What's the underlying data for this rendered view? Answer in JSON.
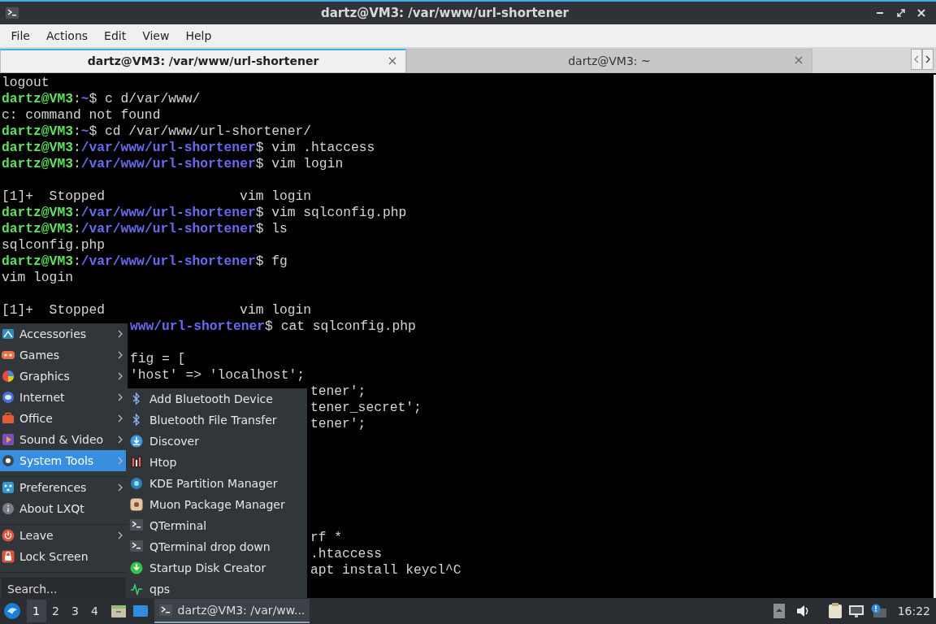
{
  "window": {
    "title": "dartz@VM3: /var/www/url-shortener"
  },
  "menu_bar": [
    "File",
    "Actions",
    "Edit",
    "View",
    "Help"
  ],
  "tabs": [
    {
      "label": "dartz@VM3: /var/www/url-shortener",
      "selected": true
    },
    {
      "label": "dartz@VM3: ~",
      "selected": false
    }
  ],
  "terminal": {
    "lines": [
      {
        "kind": "full",
        "segments": [
          {
            "kind": "text",
            "text": "logout"
          }
        ]
      },
      {
        "kind": "full",
        "segments": [
          {
            "kind": "user",
            "text": "dartz@VM3"
          },
          {
            "kind": "text",
            "text": ":"
          },
          {
            "kind": "path",
            "text": "~"
          },
          {
            "kind": "text",
            "text": "$ c d/var/www/"
          }
        ]
      },
      {
        "kind": "full",
        "segments": [
          {
            "kind": "text",
            "text": "c: command not found"
          }
        ]
      },
      {
        "kind": "full",
        "segments": [
          {
            "kind": "user",
            "text": "dartz@VM3"
          },
          {
            "kind": "text",
            "text": ":"
          },
          {
            "kind": "path",
            "text": "~"
          },
          {
            "kind": "text",
            "text": "$ cd /var/www/url-shortener/"
          }
        ]
      },
      {
        "kind": "full",
        "segments": [
          {
            "kind": "user",
            "text": "dartz@VM3"
          },
          {
            "kind": "text",
            "text": ":"
          },
          {
            "kind": "path",
            "text": "/var/www/url-shortener"
          },
          {
            "kind": "text",
            "text": "$ vim .htaccess"
          }
        ]
      },
      {
        "kind": "full",
        "segments": [
          {
            "kind": "user",
            "text": "dartz@VM3"
          },
          {
            "kind": "text",
            "text": ":"
          },
          {
            "kind": "path",
            "text": "/var/www/url-shortener"
          },
          {
            "kind": "text",
            "text": "$ vim login"
          }
        ]
      },
      {
        "kind": "blank"
      },
      {
        "kind": "full",
        "segments": [
          {
            "kind": "text",
            "text": "[1]+  Stopped                 vim login"
          }
        ]
      },
      {
        "kind": "full",
        "segments": [
          {
            "kind": "user",
            "text": "dartz@VM3"
          },
          {
            "kind": "text",
            "text": ":"
          },
          {
            "kind": "path",
            "text": "/var/www/url-shortener"
          },
          {
            "kind": "text",
            "text": "$ vim sqlconfig.php"
          }
        ]
      },
      {
        "kind": "full",
        "segments": [
          {
            "kind": "user",
            "text": "dartz@VM3"
          },
          {
            "kind": "text",
            "text": ":"
          },
          {
            "kind": "path",
            "text": "/var/www/url-shortener"
          },
          {
            "kind": "text",
            "text": "$ ls"
          }
        ]
      },
      {
        "kind": "full",
        "segments": [
          {
            "kind": "text",
            "text": "sqlconfig.php"
          }
        ]
      },
      {
        "kind": "full",
        "segments": [
          {
            "kind": "user",
            "text": "dartz@VM3"
          },
          {
            "kind": "text",
            "text": ":"
          },
          {
            "kind": "path",
            "text": "/var/www/url-shortener"
          },
          {
            "kind": "text",
            "text": "$ fg"
          }
        ]
      },
      {
        "kind": "full",
        "segments": [
          {
            "kind": "text",
            "text": "vim login"
          }
        ]
      },
      {
        "kind": "blank"
      },
      {
        "kind": "full",
        "segments": [
          {
            "kind": "text",
            "text": "[1]+  Stopped                 vim login"
          }
        ]
      },
      {
        "kind": "under-menu",
        "segments": [
          {
            "kind": "path",
            "text": "www/url-shortener"
          },
          {
            "kind": "text",
            "text": "$ cat sqlconfig.php"
          }
        ]
      },
      {
        "kind": "blank"
      },
      {
        "kind": "under-menu",
        "segments": [
          {
            "kind": "text",
            "text": "fig = ["
          }
        ]
      },
      {
        "kind": "under-menu",
        "segments": [
          {
            "kind": "text",
            "text": "'host' => 'localhost';"
          }
        ]
      },
      {
        "kind": "under-submenu",
        "segments": [
          {
            "kind": "text",
            "text": "tener';"
          }
        ]
      },
      {
        "kind": "under-submenu",
        "segments": [
          {
            "kind": "text",
            "text": "tener_secret';"
          }
        ]
      },
      {
        "kind": "under-submenu",
        "segments": [
          {
            "kind": "text",
            "text": "tener';"
          }
        ]
      },
      {
        "kind": "blank"
      },
      {
        "kind": "blank"
      },
      {
        "kind": "blank"
      },
      {
        "kind": "blank"
      },
      {
        "kind": "blank"
      },
      {
        "kind": "blank"
      },
      {
        "kind": "under-submenu",
        "segments": [
          {
            "kind": "text",
            "text": "rf *"
          }
        ]
      },
      {
        "kind": "under-submenu",
        "segments": [
          {
            "kind": "text",
            "text": ".htaccess"
          }
        ]
      },
      {
        "kind": "under-submenu",
        "segments": [
          {
            "kind": "text",
            "text": "apt install keycl^C"
          }
        ]
      }
    ]
  },
  "start_menu": {
    "sections": [
      [
        {
          "label": "Accessories",
          "submenu": true,
          "selected": false
        },
        {
          "label": "Games",
          "submenu": true,
          "selected": false
        },
        {
          "label": "Graphics",
          "submenu": true,
          "selected": false
        },
        {
          "label": "Internet",
          "submenu": true,
          "selected": false
        },
        {
          "label": "Office",
          "submenu": true,
          "selected": false
        },
        {
          "label": "Sound & Video",
          "submenu": true,
          "selected": false
        },
        {
          "label": "System Tools",
          "submenu": true,
          "selected": true
        }
      ],
      [
        {
          "label": "Preferences",
          "submenu": true,
          "selected": false
        },
        {
          "label": "About LXQt",
          "submenu": false,
          "selected": false
        }
      ],
      [
        {
          "label": "Leave",
          "submenu": true,
          "selected": false
        },
        {
          "label": "Lock Screen",
          "submenu": false,
          "selected": false
        }
      ]
    ],
    "search": {
      "placeholder": "Search..."
    }
  },
  "submenu": {
    "items": [
      {
        "label": "Add Bluetooth Device"
      },
      {
        "label": "Bluetooth File Transfer"
      },
      {
        "label": "Discover"
      },
      {
        "label": "Htop"
      },
      {
        "label": "KDE Partition Manager"
      },
      {
        "label": "Muon Package Manager"
      },
      {
        "label": "QTerminal"
      },
      {
        "label": "QTerminal drop down"
      },
      {
        "label": "Startup Disk Creator"
      },
      {
        "label": "qps"
      }
    ]
  },
  "taskbar": {
    "desktops": [
      {
        "label": "1",
        "selected": true
      },
      {
        "label": "2",
        "selected": false
      },
      {
        "label": "3",
        "selected": false
      },
      {
        "label": "4",
        "selected": false
      }
    ],
    "tasks": [
      {
        "label": "dartz@VM3: /var/ww...",
        "selected": true
      }
    ],
    "clock": "16:22"
  }
}
